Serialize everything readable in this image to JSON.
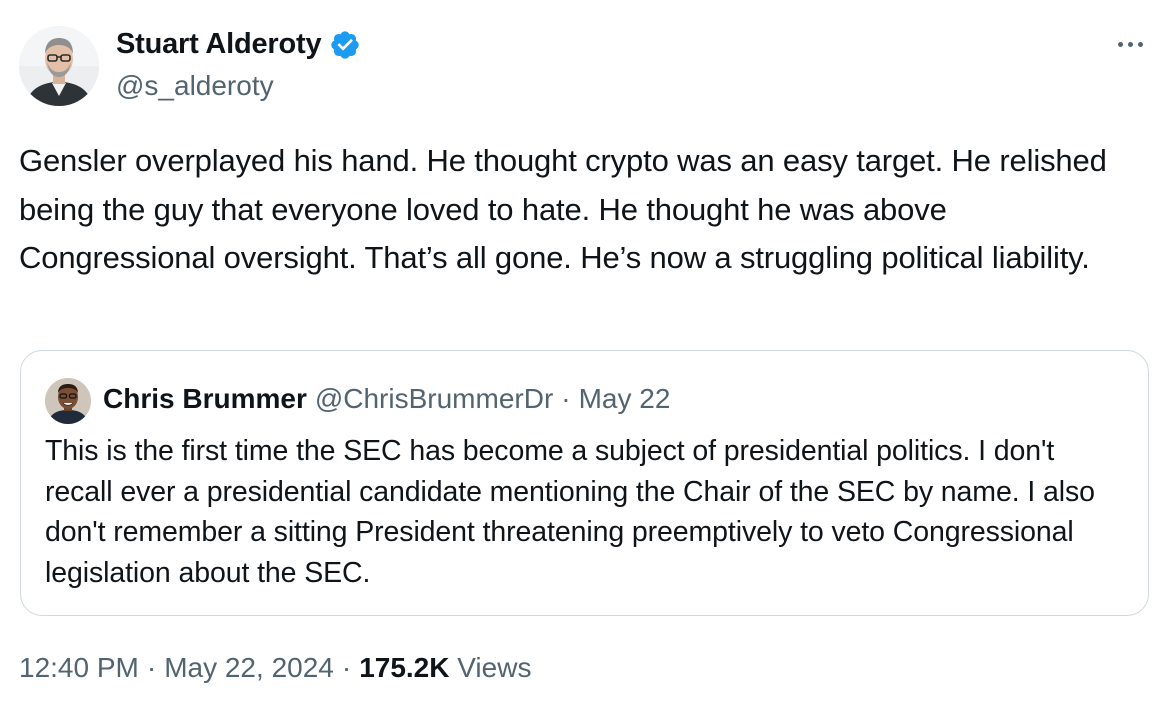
{
  "author": {
    "name": "Stuart Alderoty",
    "handle": "@s_alderoty",
    "verified": true
  },
  "tweet": {
    "text": "Gensler overplayed his hand. He thought crypto was an easy target. He relished being the guy that everyone loved to hate. He thought he was above Congressional oversight. That’s all gone. He’s now a struggling political liability."
  },
  "quote": {
    "name": "Chris Brummer",
    "handle": "@ChrisBrummerDr",
    "separator": "·",
    "date": "May 22",
    "text": "This is the first time the SEC has become a subject of presidential politics. I don't recall ever a presidential candidate mentioning the Chair of the SEC by name.  I also don't remember a sitting President threatening preemptively to veto Congressional legislation about the SEC."
  },
  "meta": {
    "time": "12:40 PM",
    "separator": "·",
    "date": "May 22, 2024",
    "views_count": "175.2K",
    "views_label": "Views"
  },
  "colors": {
    "text_primary": "#0f1419",
    "text_secondary": "#536471",
    "verified_blue": "#1d9bf0",
    "border": "#cfd9de"
  },
  "icons": {
    "verified": "verified-badge-icon",
    "more": "more-options-icon"
  }
}
